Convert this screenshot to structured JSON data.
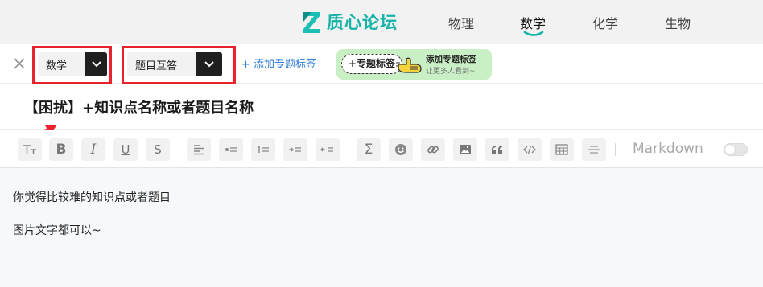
{
  "nav": {
    "brand": "质心论坛",
    "items": [
      "物理",
      "数学",
      "化学",
      "生物"
    ],
    "active_index": 1
  },
  "tags": {
    "subject_select": "数学",
    "type_select": "题目互答",
    "add_topic_link": "+ 添加专题标签",
    "topic_pill": "+专题标签",
    "bubble_title": "添加专题标签",
    "bubble_subtitle": "让更多人看到~"
  },
  "editor": {
    "title_value": "【困扰】+知识点名称或者题目名称",
    "toolbar_icons": [
      "text-size-icon",
      "bold-icon",
      "italic-icon",
      "underline-icon",
      "strikethrough-icon",
      "align-left-icon",
      "bullet-list-icon",
      "ordered-list-icon",
      "indent-icon",
      "outdent-icon",
      "formula-icon",
      "emoji-icon",
      "link-icon",
      "image-icon",
      "quote-icon",
      "code-icon",
      "table-icon",
      "horizontal-rule-icon"
    ],
    "toolbar_glyphs": {
      "bold": "B",
      "italic": "I",
      "underline": "U",
      "strike": "S",
      "formula": "Σ"
    },
    "markdown_label": "Markdown",
    "markdown_enabled": false,
    "body_lines": [
      "你觉得比较难的知识点或者题目",
      "图片文字都可以~"
    ]
  },
  "colors": {
    "brand": "#16b3a8",
    "highlight": "#e8232b",
    "link": "#2f7bd9",
    "bubble": "#c9f0c4"
  }
}
